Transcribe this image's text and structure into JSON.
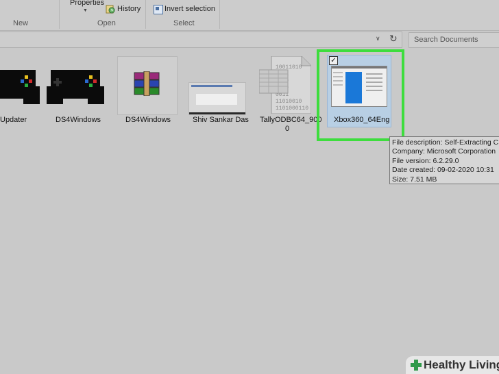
{
  "ribbon": {
    "groups": [
      {
        "label": "New"
      },
      {
        "label": "Open"
      },
      {
        "label": "Select"
      }
    ],
    "properties_label": "Properties",
    "history_label": "History",
    "invert_selection_label": "Invert selection"
  },
  "search": {
    "placeholder": "Search Documents"
  },
  "files": [
    {
      "name": "Updater",
      "icon": "gamepad-icon"
    },
    {
      "name": "DS4Windows",
      "icon": "gamepad-icon"
    },
    {
      "name": "DS4Windows",
      "icon": "winrar-archive-icon"
    },
    {
      "name": "Shiv Sankar Das",
      "icon": "screenshot-thumbnail"
    },
    {
      "name": "TallyODBC64_900",
      "name_line2": "0",
      "icon": "binary-document-icon"
    },
    {
      "name": "Xbox360_64Eng",
      "icon": "installer-thumbnail",
      "selected": true
    }
  ],
  "tooltip": {
    "description": "File description: Self-Extracting C",
    "company": "Company: Microsoft Corporation",
    "version": "File version: 6.2.29.0",
    "created": "Date created: 09-02-2020 10:31",
    "size": "Size: 7.51 MB"
  },
  "watermark": {
    "text": "Healthy Living"
  },
  "colors": {
    "highlight": "#3ddd3d",
    "selection": "#b8cfe4",
    "background": "#c9c9c9"
  }
}
